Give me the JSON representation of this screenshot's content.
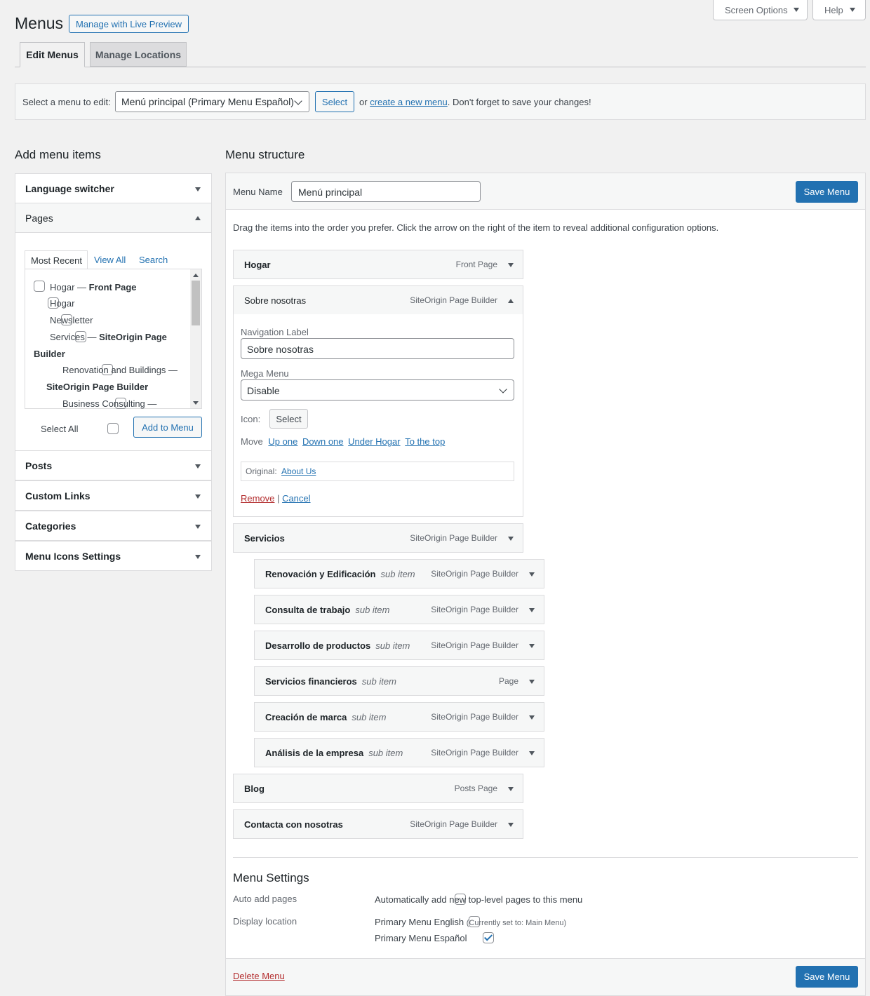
{
  "header": {
    "title": "Menus",
    "live_preview": "Manage with Live Preview",
    "screen_options": "Screen Options",
    "help": "Help"
  },
  "tabs": {
    "edit": "Edit Menus",
    "locations": "Manage Locations"
  },
  "selector": {
    "label": "Select a menu to edit:",
    "value": "Menú principal (Primary Menu Español)",
    "select_btn": "Select",
    "or": "or",
    "create_link": "create a new menu",
    "tail": ". Don't forget to save your changes!"
  },
  "left": {
    "title": "Add menu items",
    "language_switcher": "Language switcher",
    "pages": "Pages",
    "page_tabs": {
      "recent": "Most Recent",
      "all": "View All",
      "search": "Search"
    },
    "page_items": {
      "p1": "Hogar — ",
      "p1b": "Front Page",
      "p2": "Hogar",
      "p3": "Newsletter",
      "p4": "Services — ",
      "p4b": "SiteOrigin Page",
      "p4c": "Builder",
      "p5": "Renovation and Buildings —",
      "p5b": "SiteOrigin Page Builder",
      "p6": "Business Consulting —"
    },
    "select_all": "Select All",
    "add_to_menu": "Add to Menu",
    "posts": "Posts",
    "custom_links": "Custom Links",
    "categories": "Categories",
    "menu_icons": "Menu Icons Settings"
  },
  "structure": {
    "title": "Menu structure",
    "menu_name_label": "Menu Name",
    "menu_name_value": "Menú principal",
    "save": "Save Menu",
    "instructions": "Drag the items into the order you prefer. Click the arrow on the right of the item to reveal additional configuration options.",
    "sub_label": "sub item",
    "items": [
      {
        "title": "Hogar",
        "type": "Front Page"
      },
      {
        "title": "Sobre nosotras",
        "type": "SiteOrigin Page Builder"
      },
      {
        "title": "Servicios",
        "type": "SiteOrigin Page Builder"
      },
      {
        "title": "Renovación y Edificación",
        "type": "SiteOrigin Page Builder"
      },
      {
        "title": "Consulta de trabajo",
        "type": "SiteOrigin Page Builder"
      },
      {
        "title": "Desarrollo de productos",
        "type": "SiteOrigin Page Builder"
      },
      {
        "title": "Servicios financieros",
        "type": "Page"
      },
      {
        "title": "Creación de marca",
        "type": "SiteOrigin Page Builder"
      },
      {
        "title": "Análisis de la empresa",
        "type": "SiteOrigin Page Builder"
      },
      {
        "title": "Blog",
        "type": "Posts Page"
      },
      {
        "title": "Contacta con nosotras",
        "type": "SiteOrigin Page Builder"
      }
    ],
    "edit": {
      "nav_label": "Navigation Label",
      "nav_value": "Sobre nosotras",
      "mega_label": "Mega Menu",
      "mega_value": "Disable",
      "icon_label": "Icon:",
      "icon_btn": "Select",
      "move_label": "Move",
      "move_up": "Up one",
      "move_down": "Down one",
      "move_under": "Under Hogar",
      "move_top": "To the top",
      "original_label": "Original:",
      "original_link": "About Us",
      "remove": "Remove",
      "sep": "|",
      "cancel": "Cancel"
    },
    "settings": {
      "title": "Menu Settings",
      "auto_label": "Auto add pages",
      "auto_text": "Automatically add new top-level pages to this menu",
      "display_label": "Display location",
      "loc1": "Primary Menu English",
      "loc1_note": "(Currently set to: Main Menu)",
      "loc2": "Primary Menu Español"
    },
    "delete": "Delete Menu"
  }
}
